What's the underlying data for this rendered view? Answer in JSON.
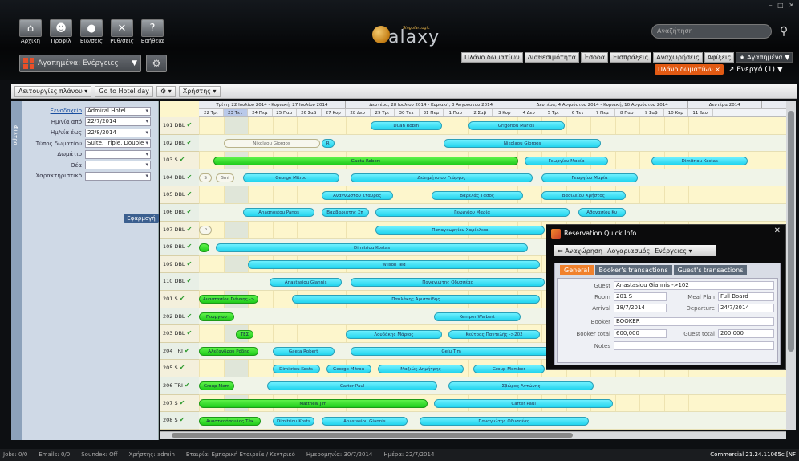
{
  "header": {
    "nav_buttons": [
      {
        "label": "Αρχική",
        "icon": "home-icon",
        "glyph": "⌂"
      },
      {
        "label": "Προφίλ",
        "icon": "profile-icon",
        "glyph": "☻"
      },
      {
        "label": "Ειδ/σεις",
        "icon": "notifications-icon",
        "glyph": "●"
      },
      {
        "label": "Ρυθ/σεις",
        "icon": "settings-icon",
        "glyph": "✕"
      },
      {
        "label": "Βοήθεια",
        "icon": "help-icon",
        "glyph": "?"
      }
    ],
    "favorites_select": "Αγαπημένα: Ενέργειες",
    "logo_text": "alaxy",
    "logo_subtext": "SingularLogic",
    "search_placeholder": "Αναζήτηση",
    "main_nav": [
      "Πλάνο δωματίων",
      "Διαθεσιμότητα",
      "Έσοδα",
      "Εισπράξεις",
      "Αναχωρήσεις",
      "Αφίξεις",
      "★ Αγαπημένα ▼"
    ],
    "plan_badge": "Πλάνο δωματίων ×",
    "active_link": "Ενεργό (1) ▼"
  },
  "toolbar": {
    "items": [
      "Λειτουργίες πλάνου ▾",
      "Go to Hotel day",
      "⚙ ▾",
      "Χρήστης ▾"
    ]
  },
  "filters": {
    "tab_label": "Φίλτρα",
    "rows": [
      {
        "label": "Ξενοδοχείο",
        "value": "Admiral Hotel",
        "link": true
      },
      {
        "label": "Ημ/νία από",
        "value": "22/7/2014"
      },
      {
        "label": "Ημ/νία έως",
        "value": "22/8/2014"
      },
      {
        "label": "Τύπος δωματίου",
        "value": "Suite, Triple, Double"
      },
      {
        "label": "Δωμάτιο",
        "value": ""
      },
      {
        "label": "Θέα",
        "value": ""
      },
      {
        "label": "Χαρακτηριστικό",
        "value": ""
      }
    ],
    "search_button": "Εφαρμογή"
  },
  "grid": {
    "weeks": [
      {
        "label": "Τρίτη, 22 Ιουλίου 2014 - Κυριακή, 27 Ιουλίου 2014",
        "days": 6
      },
      {
        "label": "Δευτέρα, 28 Ιουλίου 2014 - Κυριακή, 3 Αυγούστου 2014",
        "days": 7
      },
      {
        "label": "Δευτέρα, 4 Αυγούστου 2014 - Κυριακή, 10 Αυγούστου 2014",
        "days": 7
      },
      {
        "label": "Δευτέρα 2014",
        "days": 3
      }
    ],
    "days": [
      "22 Τρι",
      "23 Τετ",
      "24 Πεμ",
      "25 Παρ",
      "26 Σαβ",
      "27 Κυρ",
      "28 Δευ",
      "29 Τρι",
      "30 Τετ",
      "31 Πεμ",
      "1 Παρ",
      "2 Σαβ",
      "3 Κυρ",
      "4 Δευ",
      "5 Τρι",
      "6 Τετ",
      "7 Πεμ",
      "8 Παρ",
      "9 Σαβ",
      "10 Κυρ",
      "11 Δευ"
    ],
    "rooms": [
      "101 DBL",
      "102 DBL",
      "103 S",
      "104 DBL",
      "105 DBL",
      "106 DBL",
      "107 DBL",
      "108 DBL",
      "109 DBL",
      "110 DBL",
      "201 S",
      "202 DBL",
      "203 DBL",
      "204 TRI",
      "205 S",
      "206 TRI",
      "207 S",
      "208 S"
    ],
    "reservations": [
      {
        "row": 0,
        "start": 7,
        "len": 3,
        "name": "Duan Robin",
        "style": "cyan"
      },
      {
        "row": 0,
        "start": 11,
        "len": 4,
        "name": "Grigoriou Marios",
        "style": "cyan"
      },
      {
        "row": 1,
        "start": 1,
        "len": 4,
        "name": "Nikolaou Giorgos",
        "style": "white"
      },
      {
        "row": 1,
        "start": 5,
        "len": 0.6,
        "name": "R",
        "style": "cyan"
      },
      {
        "row": 1,
        "start": 10,
        "len": 6.5,
        "name": "Nikolaou Giorgos",
        "style": "cyan"
      },
      {
        "row": 2,
        "start": 0.6,
        "len": 12.5,
        "name": "Gaeta Robert",
        "style": "green"
      },
      {
        "row": 2,
        "start": 13.3,
        "len": 3.5,
        "name": "Γεωργίου Μαρία",
        "style": "cyan"
      },
      {
        "row": 2,
        "start": 18.5,
        "len": 4,
        "name": "Dimitriou Kostas",
        "style": "cyan"
      },
      {
        "row": 3,
        "start": 0,
        "len": 0.6,
        "name": "S",
        "style": "white"
      },
      {
        "row": 3,
        "start": 0.7,
        "len": 0.8,
        "name": "Smi",
        "style": "white"
      },
      {
        "row": 3,
        "start": 1.8,
        "len": 4,
        "name": "George Mitrou",
        "style": "cyan"
      },
      {
        "row": 3,
        "start": 6.2,
        "len": 7.5,
        "name": "Δελημήτσιου Γιώργος",
        "style": "cyan"
      },
      {
        "row": 3,
        "start": 14,
        "len": 4,
        "name": "Γεωργίου Μαρία",
        "style": "cyan"
      },
      {
        "row": 4,
        "start": 5,
        "len": 3,
        "name": "Αναγνωστου Σταυρος",
        "style": "cyan"
      },
      {
        "row": 4,
        "start": 9.5,
        "len": 3.8,
        "name": "Βαρελάς Τάσος",
        "style": "cyan"
      },
      {
        "row": 4,
        "start": 14,
        "len": 3.5,
        "name": "Βασιλείου Χρήστος",
        "style": "cyan"
      },
      {
        "row": 5,
        "start": 1.8,
        "len": 3,
        "name": "Anagnostou Panos",
        "style": "cyan"
      },
      {
        "row": 5,
        "start": 5,
        "len": 2,
        "name": "Βαρβαριάτης Σπ",
        "style": "cyan"
      },
      {
        "row": 5,
        "start": 7.2,
        "len": 8,
        "name": "Γεωργίου Μαρία",
        "style": "cyan"
      },
      {
        "row": 5,
        "start": 15.5,
        "len": 2,
        "name": "Αθανασίου Κυ",
        "style": "cyan"
      },
      {
        "row": 6,
        "start": 0,
        "len": 0.6,
        "name": "P",
        "style": "white"
      },
      {
        "row": 6,
        "start": 7.2,
        "len": 7,
        "name": "Παπαγεωργίου Χαρίκλεια",
        "style": "cyan"
      },
      {
        "row": 7,
        "start": 0,
        "len": 0.5,
        "name": "",
        "style": "green"
      },
      {
        "row": 7,
        "start": 0.7,
        "len": 12.8,
        "name": "Dimitriou Kostas",
        "style": "cyan"
      },
      {
        "row": 8,
        "start": 2,
        "len": 12,
        "name": "Wilson Ted",
        "style": "cyan"
      },
      {
        "row": 9,
        "start": 2.9,
        "len": 3,
        "name": "Anastasiou Giannis",
        "style": "cyan"
      },
      {
        "row": 9,
        "start": 6.2,
        "len": 8,
        "name": "Παναγιώτης Οδυσσέας",
        "style": "cyan"
      },
      {
        "row": 10,
        "start": 0,
        "len": 2.5,
        "name": "Αναστασίου Γιάννης ->",
        "style": "green"
      },
      {
        "row": 10,
        "start": 3.8,
        "len": 10.2,
        "name": "Παυλάκης Αριστείδης",
        "style": "cyan"
      },
      {
        "row": 11,
        "start": 0,
        "len": 1.5,
        "name": "Γεωργίου",
        "style": "green"
      },
      {
        "row": 11,
        "start": 9.6,
        "len": 3.6,
        "name": "Kemper Walbert",
        "style": "cyan"
      },
      {
        "row": 12,
        "start": 1.5,
        "len": 0.8,
        "name": "ΤΕΣ",
        "style": "green"
      },
      {
        "row": 12,
        "start": 6,
        "len": 4,
        "name": "Λουδάκης Μάριος",
        "style": "cyan"
      },
      {
        "row": 12,
        "start": 10.2,
        "len": 3.8,
        "name": "Κεύτρας Παντελής ->202",
        "style": "cyan"
      },
      {
        "row": 13,
        "start": 0,
        "len": 2.5,
        "name": "Αλεξανδρου Ρόδης",
        "style": "green"
      },
      {
        "row": 13,
        "start": 3,
        "len": 2.6,
        "name": "Gaeta Robert",
        "style": "cyan"
      },
      {
        "row": 13,
        "start": 6.2,
        "len": 8.3,
        "name": "Gelu Tim",
        "style": "cyan"
      },
      {
        "row": 14,
        "start": 3,
        "len": 2,
        "name": "Dimitriou Kosts",
        "style": "cyan"
      },
      {
        "row": 14,
        "start": 5.2,
        "len": 1.9,
        "name": "George Mitrou",
        "style": "cyan"
      },
      {
        "row": 14,
        "start": 7.3,
        "len": 3.6,
        "name": "Μαξιώς Δημήτρης",
        "style": "cyan"
      },
      {
        "row": 14,
        "start": 11.2,
        "len": 3,
        "name": "Group Member",
        "style": "cyan"
      },
      {
        "row": 15,
        "start": 0,
        "len": 1.5,
        "name": "Group Mem",
        "style": "green"
      },
      {
        "row": 15,
        "start": 2.8,
        "len": 7,
        "name": "Carter Paul",
        "style": "cyan"
      },
      {
        "row": 15,
        "start": 10.2,
        "len": 6,
        "name": "Σβώρος Αντώνης",
        "style": "cyan"
      },
      {
        "row": 16,
        "start": 0,
        "len": 9.4,
        "name": "Matthew Jim",
        "style": "green"
      },
      {
        "row": 16,
        "start": 9.6,
        "len": 7.4,
        "name": "Carter Paul",
        "style": "cyan"
      },
      {
        "row": 17,
        "start": 0,
        "len": 2.6,
        "name": "Αναστασόπουλος Τάκ",
        "style": "green"
      },
      {
        "row": 17,
        "start": 3,
        "len": 1.8,
        "name": "Dimitriou Kosts",
        "style": "cyan"
      },
      {
        "row": 17,
        "start": 5,
        "len": 3.6,
        "name": "Anastasiou Giannis",
        "style": "cyan"
      },
      {
        "row": 17,
        "start": 9,
        "len": 7,
        "name": "Παναγιώτης Οδυσσέας",
        "style": "cyan"
      }
    ]
  },
  "popup": {
    "title": "Reservation Quick Info",
    "menu": [
      "⇐ Αναχώρηση",
      "Λογαριασμός",
      "Ενέργειες ▾"
    ],
    "tabs": [
      "General",
      "Booker's transactions",
      "Guest's transactions"
    ],
    "fields": {
      "guest_label": "Guest",
      "guest": "Anastasiou Giannis ->102",
      "room_label": "Room",
      "room": "201 S",
      "meal_label": "Meal Plan",
      "meal": "Full Board",
      "arrival_label": "Arrival",
      "arrival": "18/7/2014",
      "departure_label": "Departure",
      "departure": "24/7/2014",
      "booker_label": "Booker",
      "booker": "BOOKER",
      "booker_total_label": "Booker total",
      "booker_total": "600,000",
      "guest_total_label": "Guest total",
      "guest_total": "200,000",
      "notes_label": "Notes",
      "notes": ""
    }
  },
  "status": {
    "items": [
      "Jobs: 0/0",
      "Emails: 0/0",
      "Soundex: Off",
      "Χρήστης: admin",
      "Εταιρία: Εμπορική Εταιρεία / Κεντρικό",
      "Ημερομηνία: 30/7/2014",
      "Ημέρα: 22/7/2014"
    ],
    "version": "Commercial 21.24.11065c [NF"
  }
}
